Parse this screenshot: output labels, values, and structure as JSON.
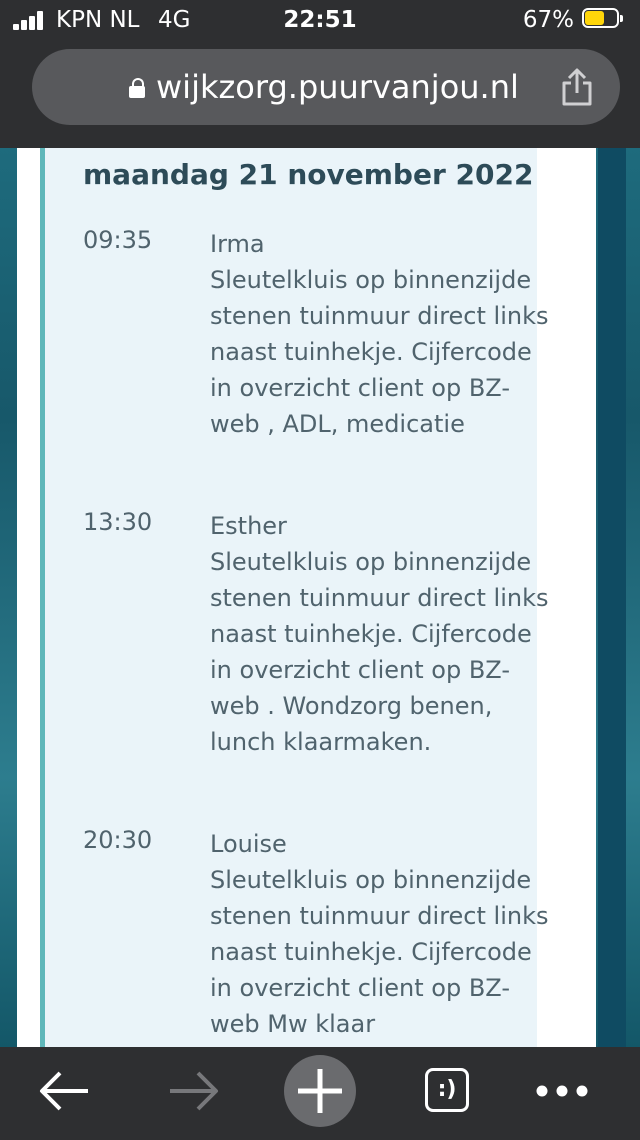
{
  "status_bar": {
    "carrier": "KPN NL",
    "network": "4G",
    "time": "22:51",
    "battery_percent": "67%",
    "battery_level": 0.67,
    "battery_color": "#ffd60a"
  },
  "browser": {
    "url": "wijkzorg.puurvanjou.nl",
    "toolbar": {
      "back_icon": "arrow-left-icon",
      "forward_icon": "arrow-right-icon",
      "new_tab_icon": "plus-icon",
      "tabs_label": ":)",
      "more_icon": "ellipsis-icon"
    }
  },
  "schedule": {
    "day_title": "maandag 21 november 2022",
    "entries": [
      {
        "time": "09:35",
        "name": "Irma",
        "note": "Sleutelkluis op binnenzijde stenen tuinmuur direct links naast tuinhekje. Cijfercode in overzicht client op BZ-web , ADL, medicatie"
      },
      {
        "time": "13:30",
        "name": "Esther",
        "note": "Sleutelkluis op binnenzijde stenen tuinmuur direct links naast tuinhekje. Cijfercode in overzicht client op BZ-web . Wondzorg benen, lunch klaarmaken."
      },
      {
        "time": "20:30",
        "name": "Louise",
        "note": "Sleutelkluis op binnenzijde stenen tuinmuur direct links naast tuinhekje. Cijfercode in overzicht client op BZ-web Mw klaar"
      }
    ]
  },
  "colors": {
    "accent_border": "#5fb7ba",
    "panel_bg": "#eaf4f9",
    "title_text": "#2d4b58",
    "body_text": "#50636d"
  }
}
